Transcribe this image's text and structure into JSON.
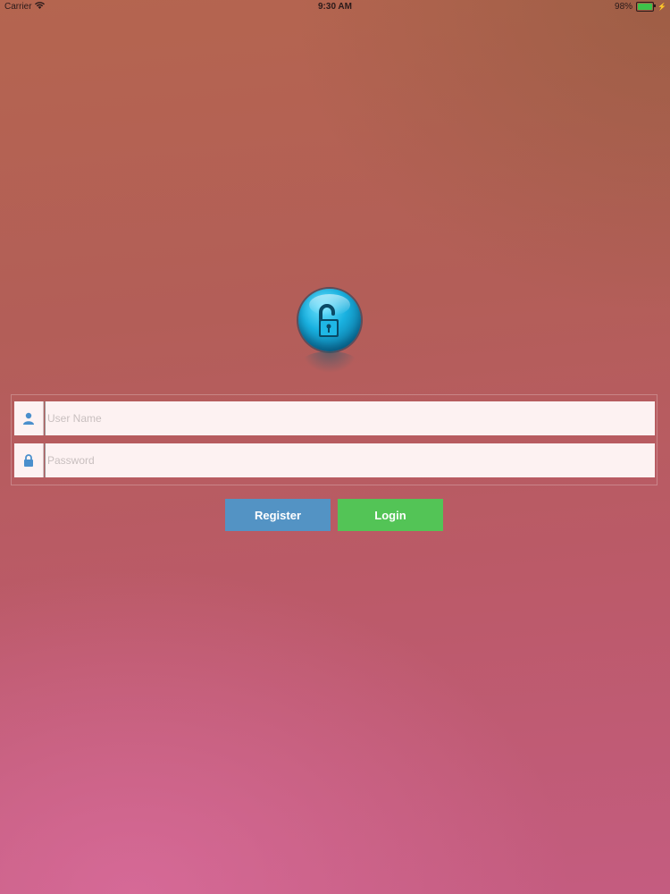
{
  "status_bar": {
    "carrier": "Carrier",
    "time": "9:30 AM",
    "battery": "98%",
    "battery_level": 0.98
  },
  "logo": {
    "icon": "unlocked-padlock-icon",
    "color": "#19b1e0"
  },
  "form": {
    "username_placeholder": "User Name",
    "password_placeholder": "Password",
    "username_icon": "user-icon",
    "password_icon": "lock-icon"
  },
  "buttons": {
    "register_label": "Register",
    "login_label": "Login",
    "register_color": "#5393c4",
    "login_color": "#53c456"
  }
}
